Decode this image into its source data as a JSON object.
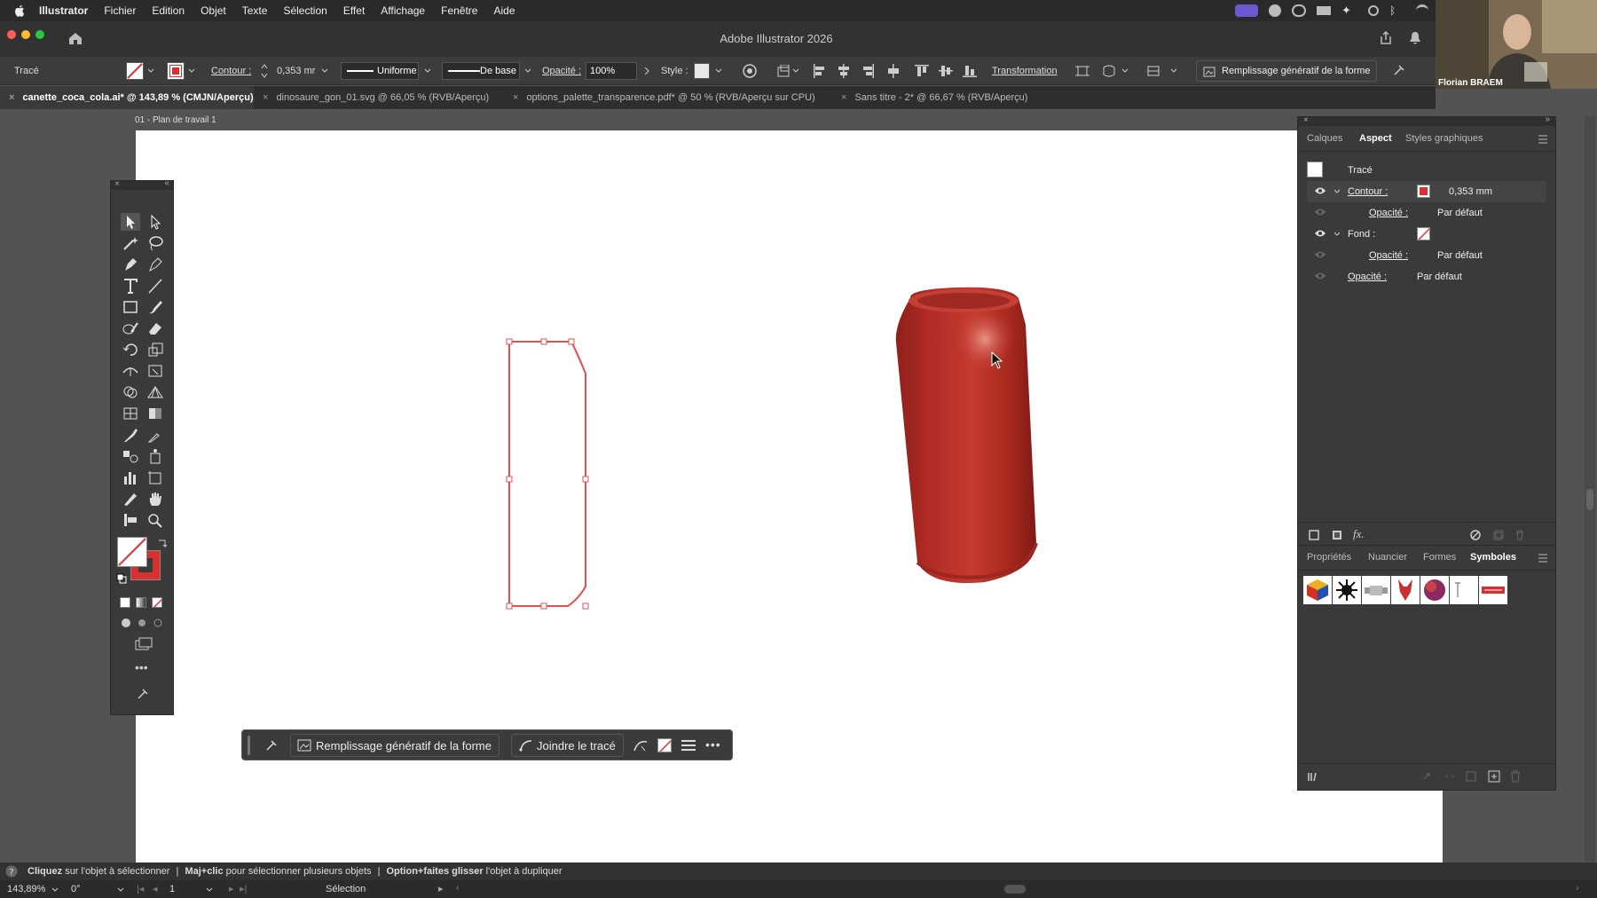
{
  "menubar": {
    "items": [
      "Illustrator",
      "Fichier",
      "Edition",
      "Objet",
      "Texte",
      "Sélection",
      "Effet",
      "Affichage",
      "Fenêtre",
      "Aide"
    ]
  },
  "window": {
    "title": "Adobe Illustrator 2026"
  },
  "control_bar": {
    "selection_label": "Tracé",
    "stroke_label": "Contour :",
    "stroke_value": "0,353 mr",
    "profile_label": "Uniforme",
    "brush_label": "De base",
    "opacity_label": "Opacité :",
    "opacity_value": "100%",
    "style_label": "Style :",
    "transform_label": "Transformation",
    "generative_fill_label": "Remplissage génératif de la forme"
  },
  "tabs": [
    {
      "label": "canette_coca_cola.ai* @ 143,89 % (CMJN/Aperçu)",
      "active": true
    },
    {
      "label": "dinosaure_gon_01.svg @ 66,05 % (RVB/Aperçu)",
      "active": false
    },
    {
      "label": "options_palette_transparence.pdf* @ 50 % (RVB/Aperçu sur CPU)",
      "active": false
    },
    {
      "label": "Sans titre - 2* @ 66,67 % (RVB/Aperçu)",
      "active": false
    }
  ],
  "artboard": {
    "label": "01 - Plan de travail 1"
  },
  "contextual_bar": {
    "generative_fill": "Remplissage génératif de la forme",
    "join_path": "Joindre le tracé"
  },
  "appearance_panel": {
    "tabs": [
      "Calques",
      "Aspect",
      "Styles graphiques"
    ],
    "active_tab": "Aspect",
    "object_type": "Tracé",
    "stroke_label": "Contour :",
    "stroke_value": "0,353 mm",
    "stroke_opacity_label": "Opacité :",
    "stroke_opacity_value": "Par défaut",
    "fill_label": "Fond :",
    "fill_opacity_label": "Opacité :",
    "fill_opacity_value": "Par défaut",
    "opacity_label": "Opacité :",
    "opacity_value": "Par défaut"
  },
  "symbols_panel": {
    "tabs": [
      "Propriétés",
      "Nuancier",
      "Formes",
      "Symboles"
    ],
    "active_tab": "Symboles"
  },
  "status": {
    "hint1_bold": "Cliquez",
    "hint1": "sur l'objet à sélectionner",
    "hint2_bold": "Maj+clic",
    "hint2": "pour sélectionner plusieurs objets",
    "hint3_bold": "Option+faites glisser",
    "hint3": "l'objet à dupliquer",
    "sep": "|"
  },
  "bottom_bar": {
    "zoom": "143,89%",
    "rotation": "0°",
    "artboard_number": "1",
    "tool_name": "Sélection"
  },
  "webcam": {
    "name": "Florian BRAEM"
  },
  "colors": {
    "accent": "#b8312a",
    "selection_red": "#e05050",
    "ui_dark": "#323232",
    "panel": "#3a3a3a"
  }
}
